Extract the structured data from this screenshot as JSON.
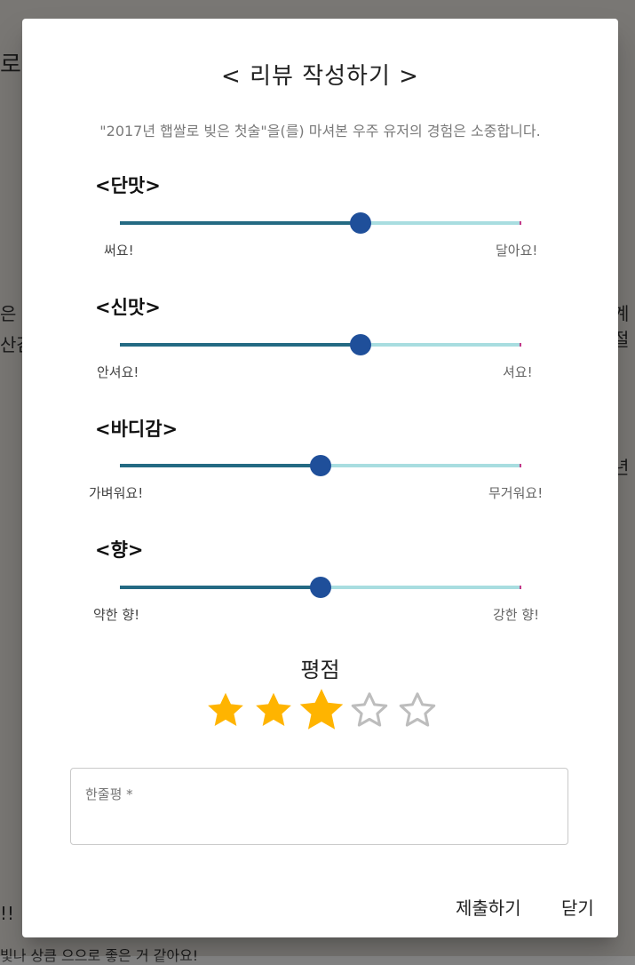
{
  "background": {
    "fragments": [
      "로",
      "은 빛",
      "산감",
      "계절",
      "년",
      "!!",
      "빛나 상큼 으으로 좋은 거 같아요!"
    ]
  },
  "dialog": {
    "title": "< 리뷰 작성하기 >",
    "subtitle": "\"2017년 햅쌀로 빚은 첫술\"을(를) 마셔본 우주 유저의 경험은 소중합니다.",
    "sliders": [
      {
        "label": "<단맛>",
        "min_label": "써요!",
        "max_label": "달아요!",
        "value": 0.6
      },
      {
        "label": "<신맛>",
        "min_label": "안셔요!",
        "max_label": "셔요!",
        "value": 0.6
      },
      {
        "label": "<바디감>",
        "min_label": "가벼워요!",
        "max_label": "무거워요!",
        "value": 0.5
      },
      {
        "label": "<향>",
        "min_label": "약한 향!",
        "max_label": "강한 향!",
        "value": 0.5
      }
    ],
    "rating": {
      "title": "평점",
      "value": 3,
      "max": 5
    },
    "review": {
      "label": "한줄평 *"
    },
    "actions": {
      "submit": "제출하기",
      "close": "닫기"
    }
  },
  "colors": {
    "track_active": "#246a83",
    "track_inactive": "#a8dde0",
    "thumb": "#1f4f9a",
    "star_filled": "#ffb400",
    "star_empty": "#bdbdbd"
  }
}
